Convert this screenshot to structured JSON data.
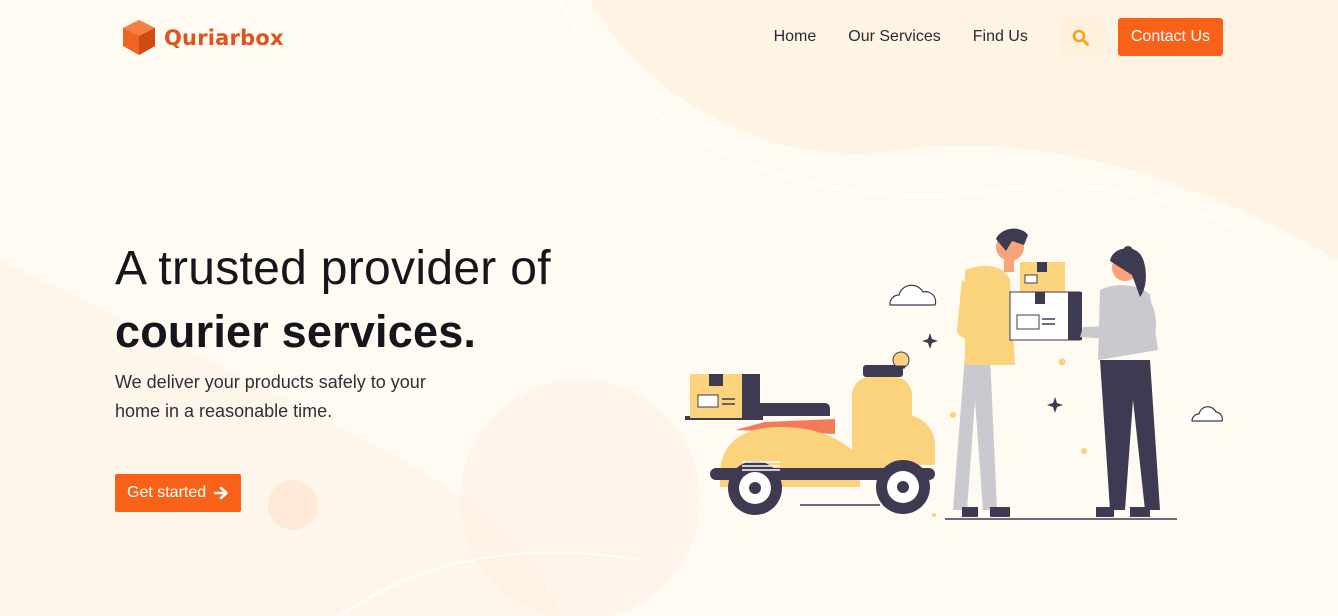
{
  "brand": {
    "name": "Quriarbox",
    "color": "#e0531c"
  },
  "nav": {
    "items": [
      {
        "label": "Home"
      },
      {
        "label": "Our Services"
      },
      {
        "label": "Find Us"
      }
    ],
    "search_icon": "search-icon",
    "contact_label": "Contact Us"
  },
  "hero": {
    "title_line1": "A trusted provider of",
    "title_line2": "courier services.",
    "description": "We deliver your products safely to your home in a reasonable time.",
    "cta_label": "Get started",
    "cta_icon": "arrow-right-icon"
  },
  "colors": {
    "accent": "#f76118",
    "background": "#fffaf2",
    "search_bg": "#fff1dc",
    "illustration_yellow": "#fcd37d",
    "illustration_dark": "#3e3a52"
  },
  "illustration": {
    "icon": "courier-delivery-illustration"
  }
}
